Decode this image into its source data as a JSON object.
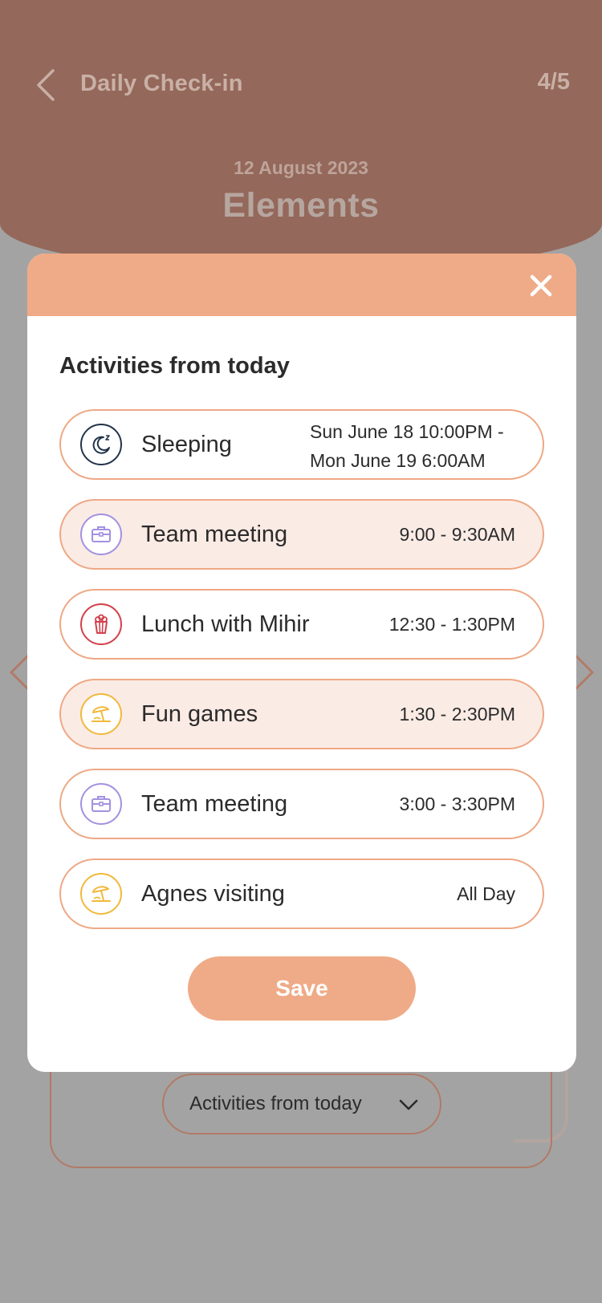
{
  "header": {
    "title": "Daily Check-in",
    "step": "4/5",
    "date": "12 August 2023",
    "section": "Elements"
  },
  "background_card": {
    "dropdown_label": "Activities from today"
  },
  "modal": {
    "title": "Activities from today",
    "activities": [
      {
        "name": "Sleeping",
        "time_line1": "Sun June 18 10:00PM -",
        "time_line2": "Mon June 19 6:00AM",
        "icon": "sleep-moon-icon",
        "icon_color": "#22344a"
      },
      {
        "name": "Team meeting",
        "time": "9:00 - 9:30AM",
        "icon": "briefcase-icon",
        "icon_color": "#a391e0"
      },
      {
        "name": "Lunch with Mihir",
        "time": "12:30 - 1:30PM",
        "icon": "popcorn-icon",
        "icon_color": "#d2404a"
      },
      {
        "name": "Fun games",
        "time": "1:30 - 2:30PM",
        "icon": "beach-umbrella-icon",
        "icon_color": "#f0b93c"
      },
      {
        "name": "Team meeting",
        "time": "3:00 - 3:30PM",
        "icon": "briefcase-icon",
        "icon_color": "#a391e0"
      },
      {
        "name": "Agnes visiting",
        "time": "All Day",
        "icon": "beach-umbrella-icon",
        "icon_color": "#f0b93c"
      }
    ],
    "save_label": "Save"
  },
  "colors": {
    "header_bg": "#94685a",
    "accent": "#efab87",
    "highlight_row": "#fbebe5",
    "overlay": "#a3a3a3"
  }
}
